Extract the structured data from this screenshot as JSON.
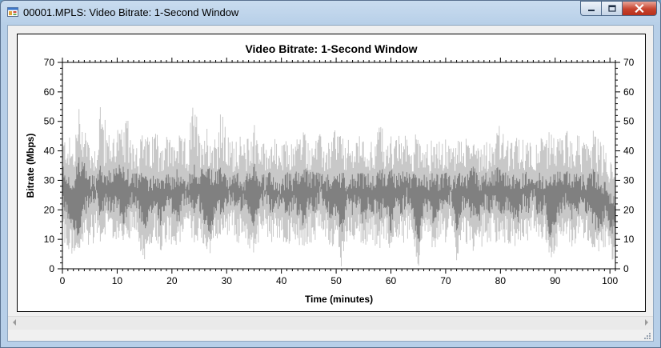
{
  "window": {
    "title": "00001.MPLS: Video Bitrate: 1-Second Window"
  },
  "icons": {
    "app": "app-window-icon",
    "minimize": "minimize-icon",
    "maximize": "maximize-icon",
    "close": "close-icon",
    "scroll_left": "scroll-left-arrow-icon",
    "scroll_right": "scroll-right-arrow-icon",
    "grip": "resize-grip-icon"
  },
  "colors": {
    "series_dark": "#808080",
    "series_light": "#c8c8c8",
    "close_button": "#c7432e"
  },
  "chart_data": {
    "type": "area",
    "title": "Video Bitrate: 1-Second Window",
    "xlabel": "Time (minutes)",
    "ylabel": "Bitrate (Mbps)",
    "xlim": [
      0,
      101
    ],
    "ylim": [
      0,
      70
    ],
    "x_ticks": [
      0,
      10,
      20,
      30,
      40,
      50,
      60,
      70,
      80,
      90,
      100
    ],
    "y_ticks": [
      0,
      10,
      20,
      30,
      40,
      50,
      60,
      70
    ],
    "grid": false,
    "legend": "none",
    "y_axis_right_mirrored": true,
    "series": [
      {
        "style": "dark-gray filled trace with light-gray peaks",
        "x": [
          0,
          1,
          2,
          3,
          4,
          5,
          6,
          7,
          8,
          9,
          10,
          11,
          12,
          13,
          14,
          15,
          16,
          17,
          18,
          19,
          20,
          21,
          22,
          23,
          24,
          25,
          26,
          27,
          28,
          29,
          30,
          31,
          32,
          33,
          34,
          35,
          36,
          37,
          38,
          39,
          40,
          41,
          42,
          43,
          44,
          45,
          46,
          47,
          48,
          49,
          50,
          51,
          52,
          53,
          54,
          55,
          56,
          57,
          58,
          59,
          60,
          61,
          62,
          63,
          64,
          65,
          66,
          67,
          68,
          69,
          70,
          71,
          72,
          73,
          74,
          75,
          76,
          77,
          78,
          79,
          80,
          81,
          82,
          83,
          84,
          85,
          86,
          87,
          88,
          89,
          90,
          91,
          92,
          93,
          94,
          95,
          96,
          97,
          98,
          99,
          100,
          101
        ],
        "peak": [
          44,
          46,
          42,
          56,
          52,
          44,
          42,
          62,
          48,
          45,
          50,
          47,
          52,
          46,
          44,
          48,
          43,
          50,
          45,
          47,
          44,
          46,
          44,
          45,
          60,
          46,
          52,
          45,
          48,
          55,
          46,
          44,
          47,
          43,
          45,
          52,
          44,
          43,
          46,
          44,
          42,
          44,
          43,
          47,
          48,
          44,
          45,
          46,
          42,
          44,
          51,
          45,
          44,
          43,
          46,
          44,
          45,
          43,
          52,
          44,
          46,
          44,
          47,
          45,
          43,
          50,
          44,
          43,
          45,
          43,
          44,
          42,
          44,
          46,
          44,
          48,
          43,
          45,
          44,
          46,
          50,
          44,
          43,
          45,
          44,
          46,
          43,
          45,
          44,
          47,
          46,
          45,
          48,
          44,
          47,
          43,
          46,
          48,
          44,
          42,
          38,
          34
        ],
        "high": [
          36,
          34,
          30,
          38,
          36,
          33,
          32,
          36,
          33,
          34,
          36,
          35,
          34,
          33,
          32,
          34,
          31,
          34,
          32,
          33,
          32,
          34,
          33,
          32,
          36,
          34,
          35,
          34,
          33,
          35,
          33,
          32,
          34,
          32,
          33,
          36,
          33,
          32,
          33,
          32,
          31,
          33,
          32,
          34,
          35,
          33,
          33,
          34,
          32,
          33,
          35,
          33,
          32,
          32,
          34,
          33,
          33,
          32,
          35,
          33,
          34,
          33,
          34,
          33,
          32,
          34,
          33,
          32,
          33,
          32,
          33,
          31,
          32,
          34,
          33,
          35,
          32,
          33,
          33,
          34,
          35,
          33,
          32,
          33,
          33,
          34,
          32,
          33,
          33,
          34,
          34,
          33,
          35,
          33,
          34,
          32,
          33,
          34,
          32,
          31,
          28,
          25
        ],
        "low": [
          20,
          16,
          14,
          8,
          18,
          20,
          22,
          16,
          20,
          18,
          20,
          14,
          18,
          22,
          18,
          10,
          16,
          20,
          14,
          20,
          18,
          14,
          20,
          22,
          18,
          20,
          14,
          10,
          20,
          18,
          20,
          22,
          18,
          20,
          16,
          12,
          20,
          22,
          18,
          20,
          20,
          16,
          20,
          18,
          14,
          20,
          18,
          22,
          20,
          16,
          18,
          10,
          20,
          18,
          22,
          14,
          20,
          18,
          16,
          20,
          12,
          20,
          18,
          22,
          18,
          4,
          20,
          18,
          14,
          20,
          18,
          22,
          12,
          20,
          18,
          16,
          14,
          20,
          18,
          20,
          16,
          20,
          18,
          14,
          20,
          18,
          22,
          16,
          20,
          10,
          14,
          18,
          20,
          16,
          18,
          20,
          18,
          14,
          12,
          16,
          12,
          10
        ],
        "trough": [
          10,
          2,
          5,
          5,
          8,
          6,
          10,
          9,
          12,
          8,
          10,
          8,
          9,
          12,
          6,
          3,
          8,
          10,
          6,
          9,
          8,
          7,
          9,
          12,
          8,
          10,
          6,
          5,
          10,
          9,
          11,
          12,
          8,
          10,
          7,
          5,
          9,
          12,
          8,
          9,
          10,
          6,
          10,
          8,
          6,
          9,
          8,
          10,
          10,
          7,
          9,
          0,
          9,
          8,
          10,
          6,
          9,
          8,
          6,
          10,
          6,
          10,
          8,
          10,
          8,
          0,
          10,
          8,
          6,
          9,
          8,
          10,
          2,
          9,
          8,
          6,
          5,
          9,
          8,
          9,
          6,
          9,
          8,
          6,
          10,
          8,
          10,
          6,
          9,
          1,
          6,
          8,
          9,
          6,
          8,
          10,
          8,
          5,
          5,
          6,
          4,
          1
        ]
      }
    ]
  }
}
